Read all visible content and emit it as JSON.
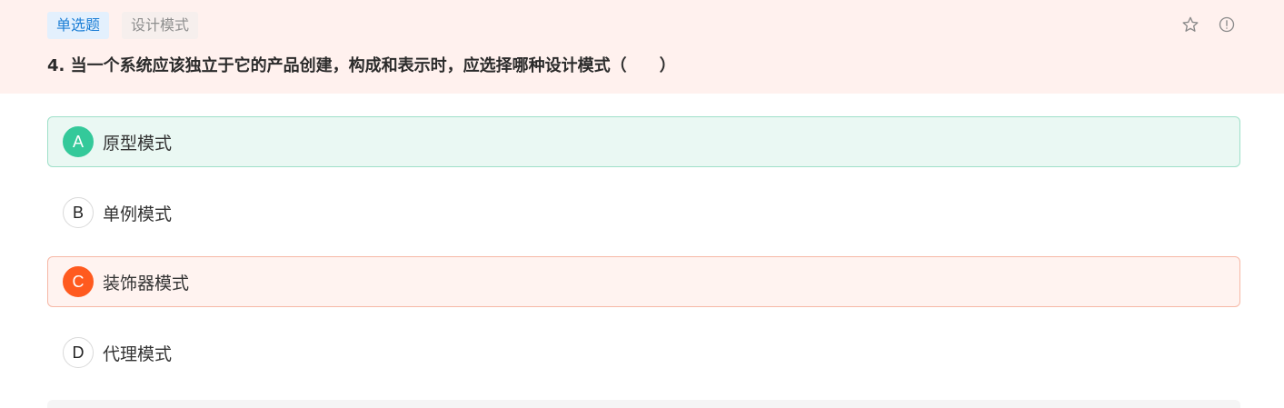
{
  "header": {
    "question_type": "单选题",
    "subject_tag": "设计模式",
    "question_text": "4. 当一个系统应该独立于它的产品创建，构成和表示时，应选择哪种设计模式（　　）",
    "icons": [
      "star-icon",
      "alert-circle-icon"
    ]
  },
  "options": [
    {
      "letter": "A",
      "text": "原型模式",
      "state": "correct"
    },
    {
      "letter": "B",
      "text": "单例模式",
      "state": "normal"
    },
    {
      "letter": "C",
      "text": "装饰器模式",
      "state": "selected-wrong"
    },
    {
      "letter": "D",
      "text": "代理模式",
      "state": "normal"
    }
  ],
  "colors": {
    "header_bg": "#fff1ee",
    "correct_green": "#34c99a",
    "wrong_orange": "#ff5a1f",
    "type_tag_blue": "#1d7fd6"
  }
}
